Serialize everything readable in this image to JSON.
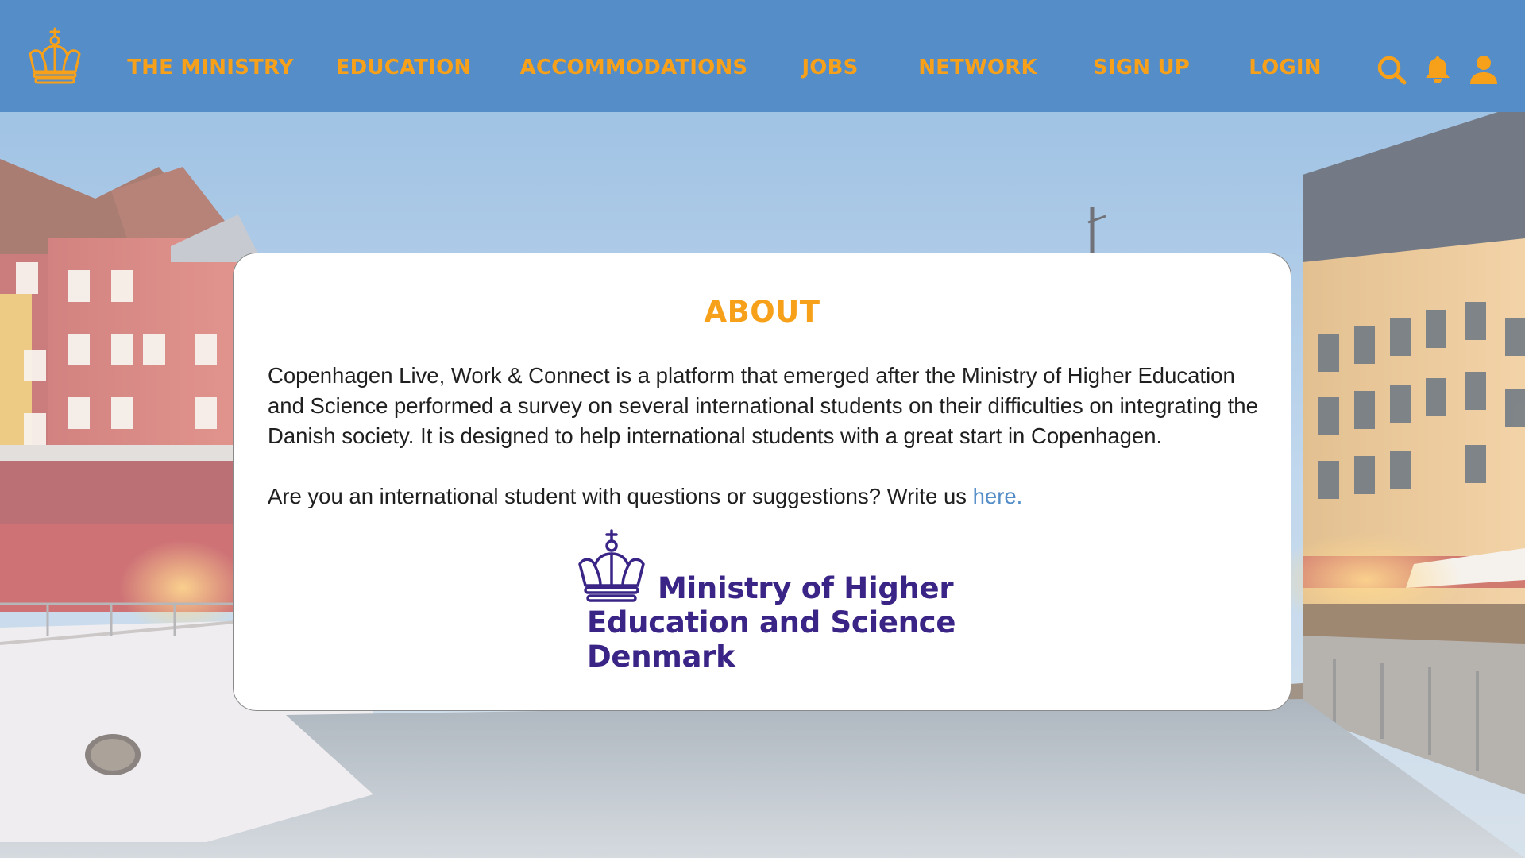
{
  "nav": {
    "items": [
      {
        "label": "THE MINISTRY"
      },
      {
        "label": "EDUCATION"
      },
      {
        "label": "ACCOMMODATIONS"
      },
      {
        "label": "JOBS"
      },
      {
        "label": "NETWORK"
      },
      {
        "label": "SIGN UP"
      },
      {
        "label": "LOGIN"
      }
    ],
    "icons": [
      "search-icon",
      "bell-icon",
      "user-icon"
    ],
    "logo_icon": "crown-icon"
  },
  "about": {
    "title": "ABOUT",
    "paragraph1": "Copenhagen Live, Work & Connect is a platform that emerged after the Ministry of Higher Education and Science performed a survey on several international students on their difficulties on integrating the Danish society. It is designed to help international students with a great start in Copenhagen.",
    "paragraph2_text": "Are you an international student with questions or suggestions? Write us ",
    "paragraph2_link": "here."
  },
  "ministry_logo": {
    "line1": "Ministry of Higher",
    "line2": "Education and Science",
    "line3": "Denmark"
  },
  "colors": {
    "header_bg": "#548dc7",
    "accent_orange": "#f7a019",
    "link_blue": "#548dc7",
    "ministry_purple": "#3a2587"
  }
}
